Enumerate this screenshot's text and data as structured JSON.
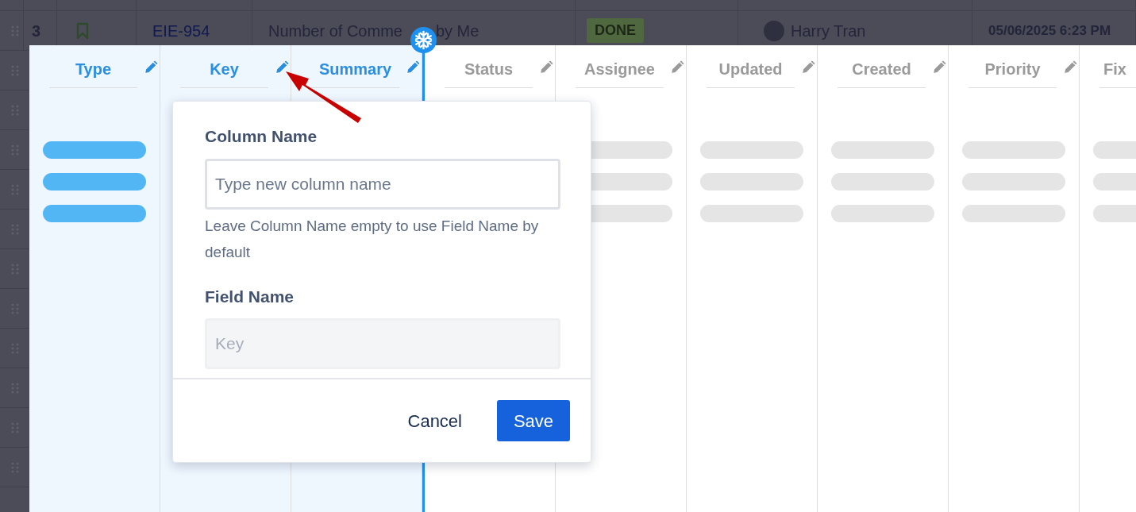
{
  "background_table": {
    "row": {
      "number": "3",
      "key": "EIE-954",
      "summary": "Number of Comme",
      "summary_end": "by Me",
      "status": "DONE",
      "assignee": "Harry Tran",
      "updated": "05/06/2025 6:23 PM"
    }
  },
  "columns": [
    {
      "label": "Type",
      "frozen": true,
      "highlighted": true
    },
    {
      "label": "Key",
      "frozen": true
    },
    {
      "label": "Summary",
      "frozen": true
    },
    {
      "label": "Status",
      "frozen": false
    },
    {
      "label": "Assignee",
      "frozen": false,
      "highlighted": false
    },
    {
      "label": "Updated",
      "frozen": false,
      "highlighted": false
    },
    {
      "label": "Created",
      "frozen": false,
      "highlighted": false
    },
    {
      "label": "Priority",
      "frozen": false,
      "highlighted": false
    },
    {
      "label": "Fix",
      "frozen": false,
      "highlighted": false
    }
  ],
  "popover": {
    "fields": [
      {
        "label": "Column Name",
        "placeholder": "Type new column name",
        "help": "Leave Column Name empty to use Field Name by default",
        "disabled": false
      },
      {
        "label": "Field Name",
        "value": "Key",
        "disabled": true
      }
    ],
    "buttons": [
      {
        "label": "Cancel",
        "kind": "link"
      },
      {
        "label": "Save",
        "kind": "primary"
      }
    ]
  }
}
